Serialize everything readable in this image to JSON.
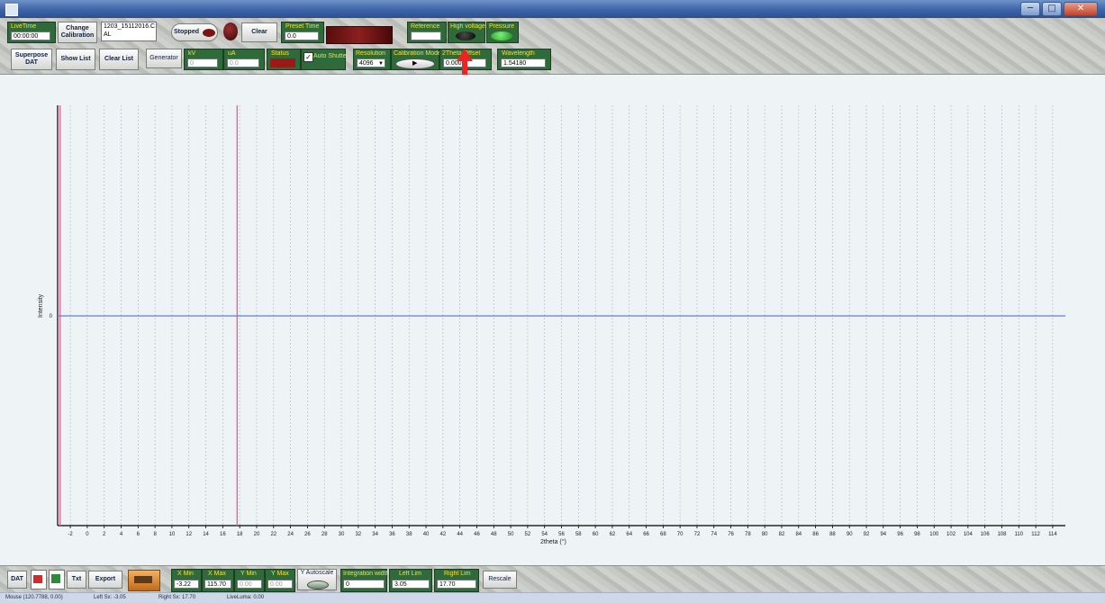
{
  "window": {
    "minimize": "─",
    "maximize": "□",
    "close": "✕"
  },
  "toolbar": {
    "live_time_label": "LiveTime",
    "live_time_value": "00:00:00",
    "change_calibration": "Change Calibration",
    "calibration_file": "1203_15112016.C AL",
    "stopped_label": "Stopped",
    "clear_label": "Clear",
    "preset_time_label": "Preset Time",
    "preset_time_value": "0.0",
    "reference_label": "Reference",
    "high_voltage_label": "High voltage",
    "pressure_label": "Pressure",
    "superpose_dat": "Superpose DAT",
    "show_list": "Show List",
    "clear_list": "Clear List",
    "generator_label": "Generator",
    "kv_label": "kV",
    "kv_value": "0",
    "ua_label": "uA",
    "ua_value": "0.0",
    "status_label": "Status",
    "auto_shutter_label": "Auto Shutter",
    "resolution_label": "Resolution",
    "resolution_value": "4096",
    "calibration_mode_label": "Calibration Mode",
    "two_theta_offset_label": "2Theta Offset",
    "two_theta_offset_value": "0.000",
    "wavelength_label": "Wavelength",
    "wavelength_value": "1.54180"
  },
  "plot": {
    "ylabel": "Intensity",
    "xlabel": "2theta (°)",
    "y_tick_zero": "0",
    "colors": {
      "baseline": "#5b7fe0",
      "marker": "#f0609a",
      "grid": "#aeb8c0",
      "axis": "#000000"
    }
  },
  "chart_data": {
    "type": "line",
    "xlabel": "2theta (°)",
    "ylabel": "Intensity",
    "xlim": [
      -3.5,
      115.5
    ],
    "x_ticks": [
      -2,
      0,
      2,
      4,
      6,
      8,
      10,
      12,
      14,
      16,
      18,
      20,
      22,
      24,
      26,
      28,
      30,
      32,
      34,
      36,
      38,
      40,
      42,
      44,
      46,
      48,
      50,
      52,
      54,
      56,
      58,
      60,
      62,
      64,
      66,
      68,
      70,
      72,
      74,
      76,
      78,
      80,
      82,
      84,
      86,
      88,
      90,
      92,
      94,
      96,
      98,
      100,
      102,
      104,
      106,
      108,
      110,
      112,
      114
    ],
    "y_ticks": [
      0
    ],
    "series": [
      {
        "x": [
          -3.5,
          115.5
        ],
        "values": [
          0,
          0
        ]
      }
    ],
    "markers": [
      {
        "x": -3.22
      },
      {
        "x": 17.7
      }
    ],
    "grid": true
  },
  "bottom": {
    "dat_label": "DAT",
    "txt_label": "Txt",
    "export_label": "Export",
    "x_min_label": "X Min",
    "x_min_value": "-3.22",
    "x_max_label": "X Max",
    "x_max_value": "115.70",
    "y_min_label": "Y Min",
    "y_min_value": "0.00",
    "y_max_label": "Y Max",
    "y_max_value": "0.00",
    "y_autoscale_label": "Y Autoscale",
    "integration_label": "Integration width",
    "integration_value": "0",
    "left_lim_label": "Left Lim",
    "left_lim_value": "3.05",
    "right_lim_label": "Right Lim",
    "right_lim_value": "17.70",
    "rescale_label": "Rescale"
  },
  "status": {
    "mouse": "Mouse (120.7788, 0.00)",
    "left_sx": "Left Sx: -3.05",
    "right_sx": "Right Sx: 17.70",
    "liveLuma": "LiveLuma: 0.00"
  }
}
